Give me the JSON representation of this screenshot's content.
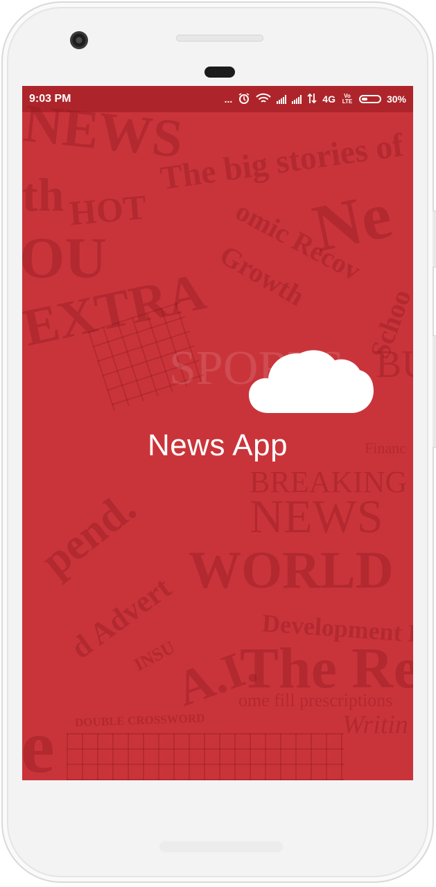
{
  "status_bar": {
    "time": "9:03 PM",
    "more": "...",
    "network": "4G",
    "volte": "Vo LTE",
    "battery": "30%"
  },
  "app": {
    "name": "News App",
    "icon": "cloud-icon"
  },
  "background_headlines": {
    "news_top": "NEWS",
    "big_stories": "The big stories of",
    "hot": "HOT",
    "growth": "Growth",
    "economic": "omic Recov",
    "extra": "EXTRA",
    "sports": "SPORTS",
    "bu": "BU",
    "finance": "Financ",
    "breaking": "BREAKING",
    "news_mid": "NEWS",
    "spend": "pend.",
    "world": "WORLD",
    "advert": "d Advert",
    "development": "Development P",
    "the_rel": "The Rel",
    "insu": "INSU",
    "ai": "A.I.",
    "prescriptions": "ome fill prescriptions",
    "writing": "Writin",
    "crossword": "DOUBLE CROSSWORD",
    "ne": "Ne",
    "schoo": "Schoo",
    "th": "th",
    "ou": "OU",
    "e": "e"
  },
  "colors": {
    "screen_red": "#c9343a",
    "status_bar_overlay": "#96191e",
    "text_white": "#ffffff"
  }
}
